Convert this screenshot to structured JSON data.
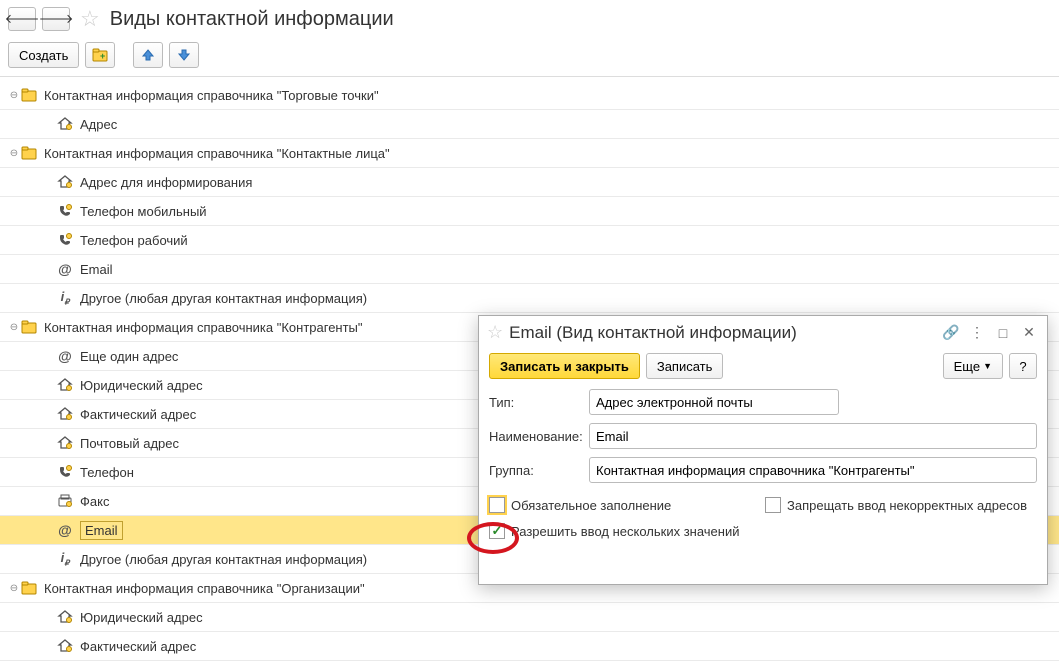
{
  "header": {
    "title": "Виды контактной информации"
  },
  "toolbar": {
    "create": "Создать"
  },
  "tree": [
    {
      "type": "group",
      "label": "Контактная информация справочника \"Торговые точки\"",
      "expand": "−"
    },
    {
      "type": "item",
      "icon": "home",
      "label": "Адрес"
    },
    {
      "type": "group",
      "label": "Контактная информация справочника \"Контактные лица\"",
      "expand": "−"
    },
    {
      "type": "item",
      "icon": "home",
      "label": "Адрес для информирования"
    },
    {
      "type": "item",
      "icon": "phone",
      "label": "Телефон мобильный"
    },
    {
      "type": "item",
      "icon": "phone",
      "label": "Телефон рабочий"
    },
    {
      "type": "item",
      "icon": "at",
      "label": "Email"
    },
    {
      "type": "item",
      "icon": "info",
      "label": "Другое (любая другая контактная информация)"
    },
    {
      "type": "group",
      "label": "Контактная информация справочника \"Контрагенты\"",
      "expand": "−"
    },
    {
      "type": "item",
      "icon": "at",
      "label": "Еще один адрес"
    },
    {
      "type": "item",
      "icon": "home",
      "label": "Юридический адрес"
    },
    {
      "type": "item",
      "icon": "home",
      "label": "Фактический адрес"
    },
    {
      "type": "item",
      "icon": "home",
      "label": "Почтовый адрес"
    },
    {
      "type": "item",
      "icon": "phone",
      "label": "Телефон"
    },
    {
      "type": "item",
      "icon": "fax",
      "label": "Факс"
    },
    {
      "type": "item",
      "icon": "at",
      "label": "Email",
      "selected": true
    },
    {
      "type": "item",
      "icon": "info",
      "label": "Другое (любая другая контактная информация)"
    },
    {
      "type": "group",
      "label": "Контактная информация справочника \"Организации\"",
      "expand": "−"
    },
    {
      "type": "item",
      "icon": "home",
      "label": "Юридический адрес"
    },
    {
      "type": "item",
      "icon": "home",
      "label": "Фактический адрес"
    }
  ],
  "dialog": {
    "title": "Email (Вид контактной информации)",
    "save_close": "Записать и закрыть",
    "save": "Записать",
    "more": "Еще",
    "help": "?",
    "type_label": "Тип:",
    "type_value": "Адрес электронной почты",
    "name_label": "Наименование:",
    "name_value": "Email",
    "group_label": "Группа:",
    "group_value": "Контактная информация справочника \"Контрагенты\"",
    "check_required": "Обязательное заполнение",
    "check_prohibit": "Запрещать ввод некорректных адресов",
    "check_multi": "Разрешить ввод нескольких значений"
  }
}
